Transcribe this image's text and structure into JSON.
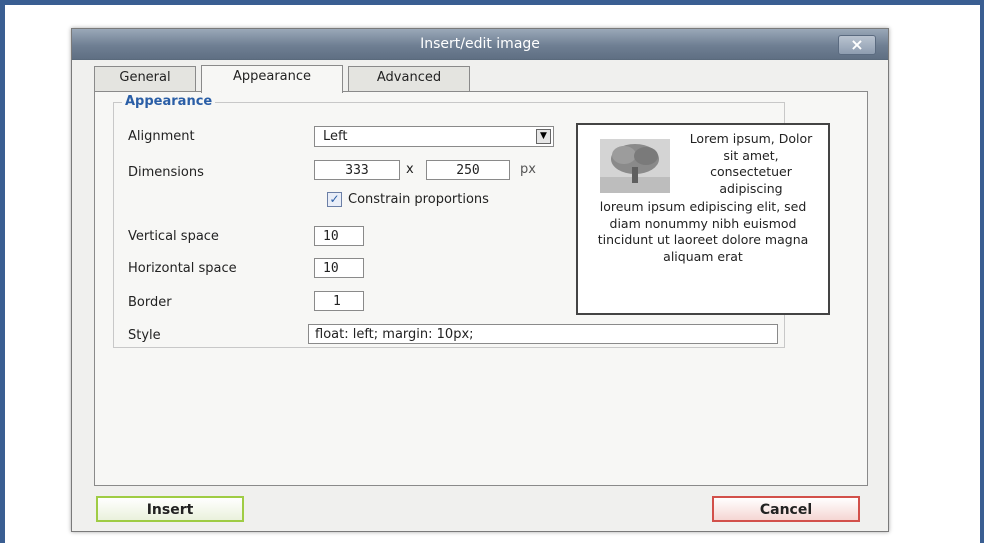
{
  "dialog": {
    "title": "Insert/edit image",
    "close_label": "×"
  },
  "tabs": [
    {
      "label": "General",
      "active": false
    },
    {
      "label": "Appearance",
      "active": true
    },
    {
      "label": "Advanced",
      "active": false
    }
  ],
  "appearance": {
    "legend": "Appearance",
    "alignment": {
      "label": "Alignment",
      "value": "Left"
    },
    "dimensions": {
      "label": "Dimensions",
      "width": "333",
      "separator": "x",
      "height": "250",
      "unit": "px"
    },
    "constrain": {
      "label": "Constrain proportions",
      "checked": true
    },
    "vertical_space": {
      "label": "Vertical space",
      "value": "10"
    },
    "horizontal_space": {
      "label": "Horizontal space",
      "value": "10"
    },
    "border": {
      "label": "Border",
      "value": "1"
    },
    "style": {
      "label": "Style",
      "value": "float: left; margin: 10px;"
    }
  },
  "preview": {
    "text_top": "Lorem ipsum, Dolor sit amet, consectetuer adipiscing",
    "text_bottom": "loreum ipsum edipiscing elit, sed diam nonummy nibh euismod tincidunt ut laoreet dolore magna aliquam erat"
  },
  "buttons": {
    "insert": "Insert",
    "cancel": "Cancel"
  },
  "colors": {
    "legend": "#2a5ea6",
    "insert_border": "#9fcc44",
    "cancel_border": "#d2504a",
    "frame": "#3a5e92"
  }
}
